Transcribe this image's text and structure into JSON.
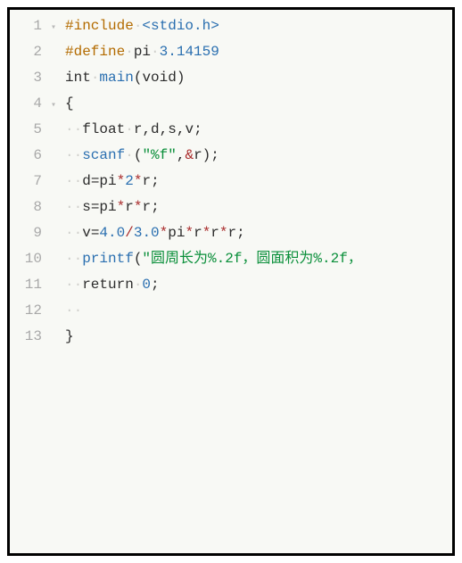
{
  "lines": [
    {
      "num": "1",
      "fold": "▾",
      "tokens": [
        {
          "t": "pp",
          "v": "#include"
        },
        {
          "t": "ws",
          "v": "·"
        },
        {
          "t": "inc",
          "v": "<stdio.h>"
        }
      ]
    },
    {
      "num": "2",
      "fold": "",
      "tokens": [
        {
          "t": "pp",
          "v": "#define"
        },
        {
          "t": "ws",
          "v": "·"
        },
        {
          "t": "id",
          "v": "pi"
        },
        {
          "t": "ws",
          "v": "·"
        },
        {
          "t": "num",
          "v": "3.14159"
        }
      ]
    },
    {
      "num": "3",
      "fold": "",
      "tokens": [
        {
          "t": "type",
          "v": "int"
        },
        {
          "t": "ws",
          "v": "·"
        },
        {
          "t": "fn",
          "v": "main"
        },
        {
          "t": "paren",
          "v": "("
        },
        {
          "t": "type",
          "v": "void"
        },
        {
          "t": "paren",
          "v": ")"
        }
      ]
    },
    {
      "num": "4",
      "fold": "▾",
      "tokens": [
        {
          "t": "brace",
          "v": "{"
        }
      ]
    },
    {
      "num": "5",
      "fold": "",
      "tokens": [
        {
          "t": "ws",
          "v": "··"
        },
        {
          "t": "type",
          "v": "float"
        },
        {
          "t": "ws",
          "v": "·"
        },
        {
          "t": "id",
          "v": "r"
        },
        {
          "t": "punct",
          "v": ","
        },
        {
          "t": "id",
          "v": "d"
        },
        {
          "t": "punct",
          "v": ","
        },
        {
          "t": "id",
          "v": "s"
        },
        {
          "t": "punct",
          "v": ","
        },
        {
          "t": "id",
          "v": "v"
        },
        {
          "t": "punct",
          "v": ";"
        }
      ]
    },
    {
      "num": "6",
      "fold": "",
      "tokens": [
        {
          "t": "ws",
          "v": "··"
        },
        {
          "t": "fn",
          "v": "scanf"
        },
        {
          "t": "ws",
          "v": "·"
        },
        {
          "t": "paren",
          "v": "("
        },
        {
          "t": "str",
          "v": "\"%f\""
        },
        {
          "t": "punct",
          "v": ","
        },
        {
          "t": "op",
          "v": "&"
        },
        {
          "t": "id",
          "v": "r"
        },
        {
          "t": "paren",
          "v": ")"
        },
        {
          "t": "punct",
          "v": ";"
        }
      ]
    },
    {
      "num": "7",
      "fold": "",
      "tokens": [
        {
          "t": "ws",
          "v": "··"
        },
        {
          "t": "id",
          "v": "d"
        },
        {
          "t": "eq",
          "v": "="
        },
        {
          "t": "id",
          "v": "pi"
        },
        {
          "t": "op",
          "v": "*"
        },
        {
          "t": "num",
          "v": "2"
        },
        {
          "t": "op",
          "v": "*"
        },
        {
          "t": "id",
          "v": "r"
        },
        {
          "t": "punct",
          "v": ";"
        }
      ]
    },
    {
      "num": "8",
      "fold": "",
      "tokens": [
        {
          "t": "ws",
          "v": "··"
        },
        {
          "t": "id",
          "v": "s"
        },
        {
          "t": "eq",
          "v": "="
        },
        {
          "t": "id",
          "v": "pi"
        },
        {
          "t": "op",
          "v": "*"
        },
        {
          "t": "id",
          "v": "r"
        },
        {
          "t": "op",
          "v": "*"
        },
        {
          "t": "id",
          "v": "r"
        },
        {
          "t": "punct",
          "v": ";"
        }
      ]
    },
    {
      "num": "9",
      "fold": "",
      "tokens": [
        {
          "t": "ws",
          "v": "··"
        },
        {
          "t": "id",
          "v": "v"
        },
        {
          "t": "eq",
          "v": "="
        },
        {
          "t": "num",
          "v": "4.0"
        },
        {
          "t": "op",
          "v": "/"
        },
        {
          "t": "num",
          "v": "3.0"
        },
        {
          "t": "op",
          "v": "*"
        },
        {
          "t": "id",
          "v": "pi"
        },
        {
          "t": "op",
          "v": "*"
        },
        {
          "t": "id",
          "v": "r"
        },
        {
          "t": "op",
          "v": "*"
        },
        {
          "t": "id",
          "v": "r"
        },
        {
          "t": "op",
          "v": "*"
        },
        {
          "t": "id",
          "v": "r"
        },
        {
          "t": "punct",
          "v": ";"
        }
      ]
    },
    {
      "num": "10",
      "fold": "",
      "tokens": [
        {
          "t": "ws",
          "v": "··"
        },
        {
          "t": "fn",
          "v": "printf"
        },
        {
          "t": "paren",
          "v": "("
        },
        {
          "t": "str",
          "v": "\"圆周长为%.2f，圆面积为%.2f，"
        }
      ]
    },
    {
      "num": "11",
      "fold": "",
      "tokens": [
        {
          "t": "ws",
          "v": "··"
        },
        {
          "t": "kw",
          "v": "return"
        },
        {
          "t": "ws",
          "v": "·"
        },
        {
          "t": "num",
          "v": "0"
        },
        {
          "t": "punct",
          "v": ";"
        }
      ]
    },
    {
      "num": "12",
      "fold": "",
      "tokens": [
        {
          "t": "ws",
          "v": "··"
        }
      ]
    },
    {
      "num": "13",
      "fold": "",
      "tokens": [
        {
          "t": "brace",
          "v": "}"
        }
      ]
    }
  ]
}
